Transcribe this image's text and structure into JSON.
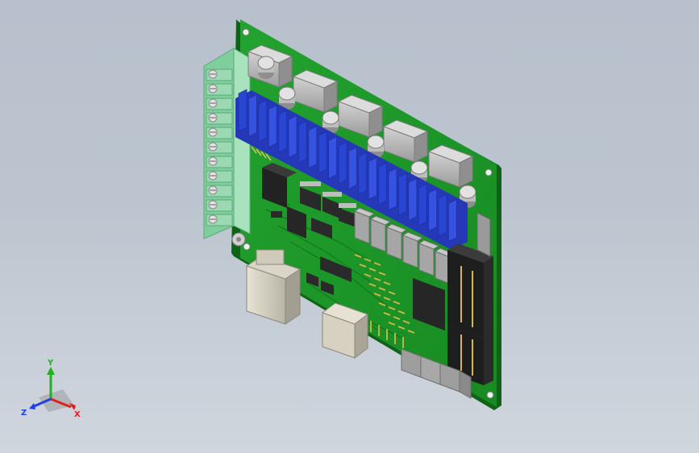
{
  "viewport": {
    "background_top": "#b7c0cc",
    "background_bottom": "#d0d6de"
  },
  "model": {
    "type": "pcb-assembly",
    "pcb_color": "#1f9a2a",
    "terminal_block_color": "#8fd7a8",
    "heatsink_color": "#2f49d6",
    "relay_color": "#b9b9b9",
    "connector_color": "#262626",
    "relay_count": 5,
    "capacitor_count": 6,
    "terminal_count": 11,
    "heatsink_fin_count": 22
  },
  "triad": {
    "x_label": "X",
    "y_label": "Y",
    "z_label": "Z",
    "x_color": "#e02020",
    "y_color": "#20b020",
    "z_color": "#2040e0"
  }
}
